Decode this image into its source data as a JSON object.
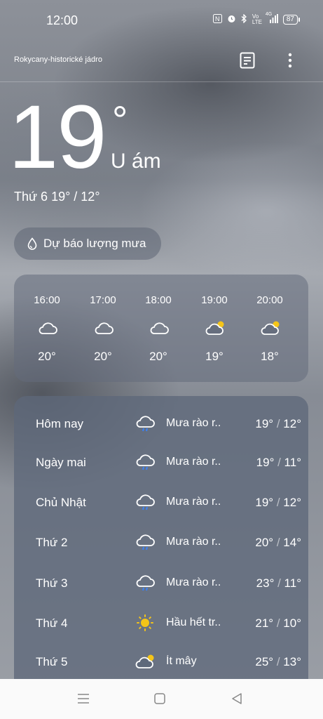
{
  "status_bar": {
    "time": "12:00",
    "battery": "87",
    "network": "4G",
    "volte": "Vo LTE"
  },
  "header": {
    "location": "Rokycany-historické jádro"
  },
  "current": {
    "temperature": "19",
    "degree_symbol": "°",
    "condition": "U ám",
    "today_range": "Thứ 6 19° / 12°"
  },
  "rain_button": {
    "label": "Dự báo lượng mưa"
  },
  "hourly": [
    {
      "time": "16:00",
      "icon": "cloud-icon",
      "temp": "20°"
    },
    {
      "time": "17:00",
      "icon": "cloud-icon",
      "temp": "20°"
    },
    {
      "time": "18:00",
      "icon": "cloud-icon",
      "temp": "20°"
    },
    {
      "time": "19:00",
      "icon": "partly-cloudy-icon",
      "temp": "19°"
    },
    {
      "time": "20:00",
      "icon": "partly-cloudy-icon",
      "temp": "18°"
    }
  ],
  "daily": [
    {
      "day": "Hôm nay",
      "icon": "rain-shower-icon",
      "condition": "Mưa rào r..",
      "high": "19°",
      "low": "12°"
    },
    {
      "day": "Ngày mai",
      "icon": "rain-shower-icon",
      "condition": "Mưa rào r..",
      "high": "19°",
      "low": "11°"
    },
    {
      "day": "Chủ Nhật",
      "icon": "rain-shower-icon",
      "condition": "Mưa rào r..",
      "high": "19°",
      "low": "12°"
    },
    {
      "day": "Thứ 2",
      "icon": "rain-shower-icon",
      "condition": "Mưa rào r..",
      "high": "20°",
      "low": "14°"
    },
    {
      "day": "Thứ 3",
      "icon": "rain-shower-icon",
      "condition": "Mưa rào r..",
      "high": "23°",
      "low": "11°"
    },
    {
      "day": "Thứ 4",
      "icon": "sun-icon",
      "condition": "Hầu hết tr..",
      "high": "21°",
      "low": "10°"
    },
    {
      "day": "Thứ 5",
      "icon": "partly-cloudy-icon",
      "condition": "Ít mây",
      "high": "25°",
      "low": "13°"
    }
  ],
  "colors": {
    "sun": "#f5c518",
    "rain_drop": "#3b82f6",
    "panel": "#5e687a",
    "navbar": "#fafafa"
  }
}
